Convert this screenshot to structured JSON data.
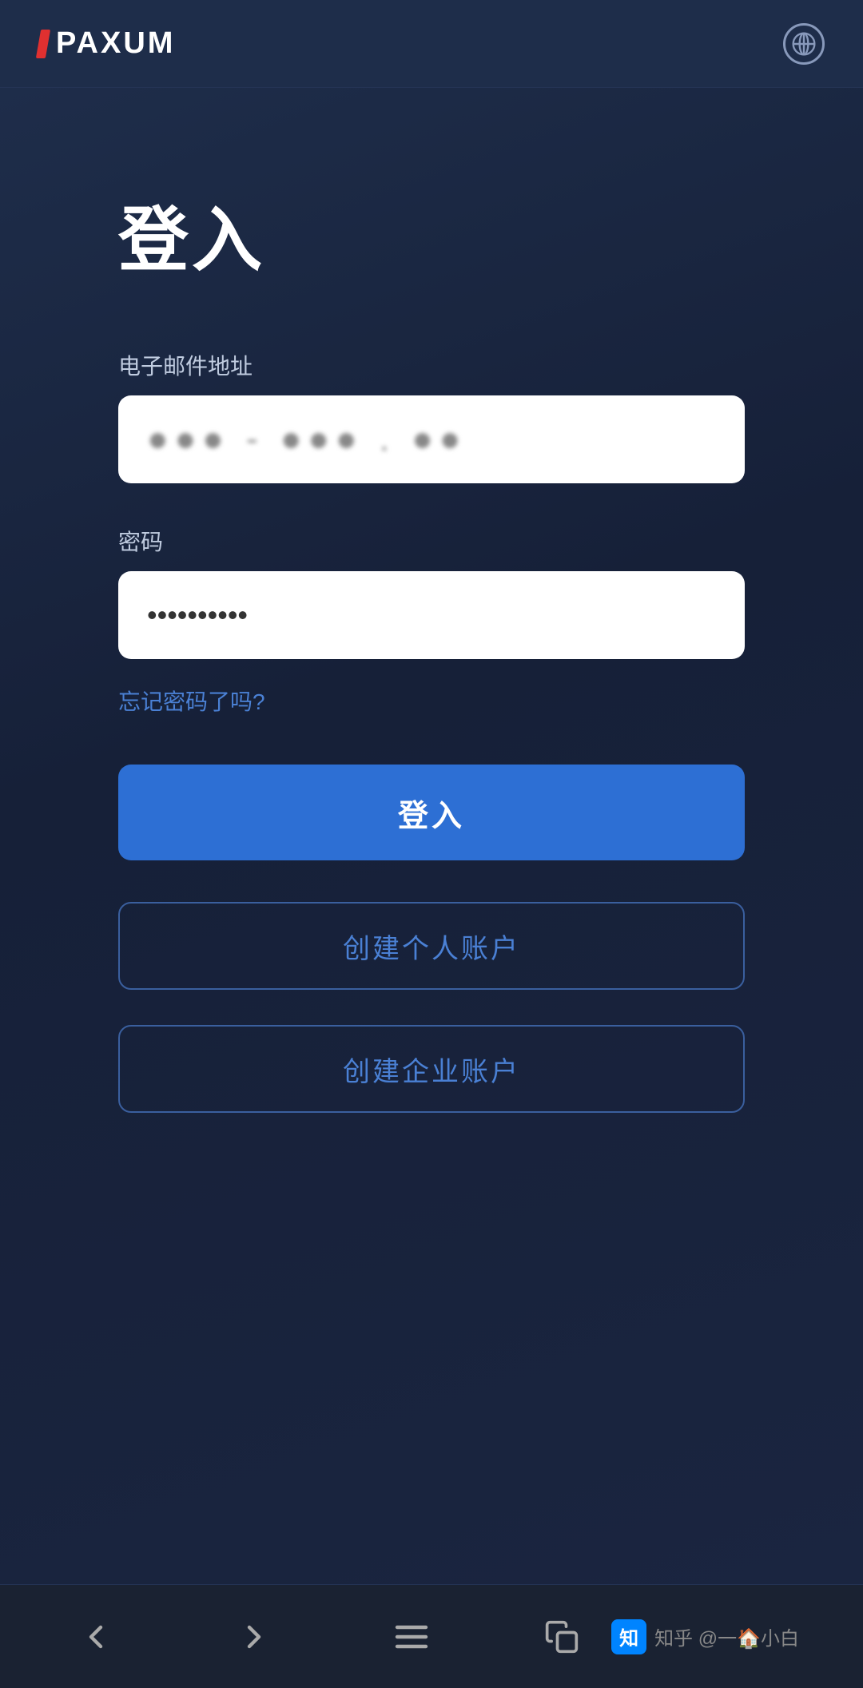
{
  "header": {
    "logo_text": "PAXUM",
    "globe_label": "Language selector"
  },
  "page": {
    "title": "登入",
    "email_label": "电子邮件地址",
    "email_placeholder": "••• - ••• . ••",
    "password_label": "密码",
    "password_value": "••••••••••",
    "forgot_password_text": "忘记密码了吗?",
    "login_button": "登入",
    "create_personal_button": "创建个人账户",
    "create_business_button": "创建企业账户"
  },
  "bottom_nav": {
    "back_label": "Back",
    "forward_label": "Forward",
    "menu_label": "Menu",
    "copy_label": "Copy",
    "watermark_text": "知乎 @一",
    "watermark_suffix": "小白"
  }
}
